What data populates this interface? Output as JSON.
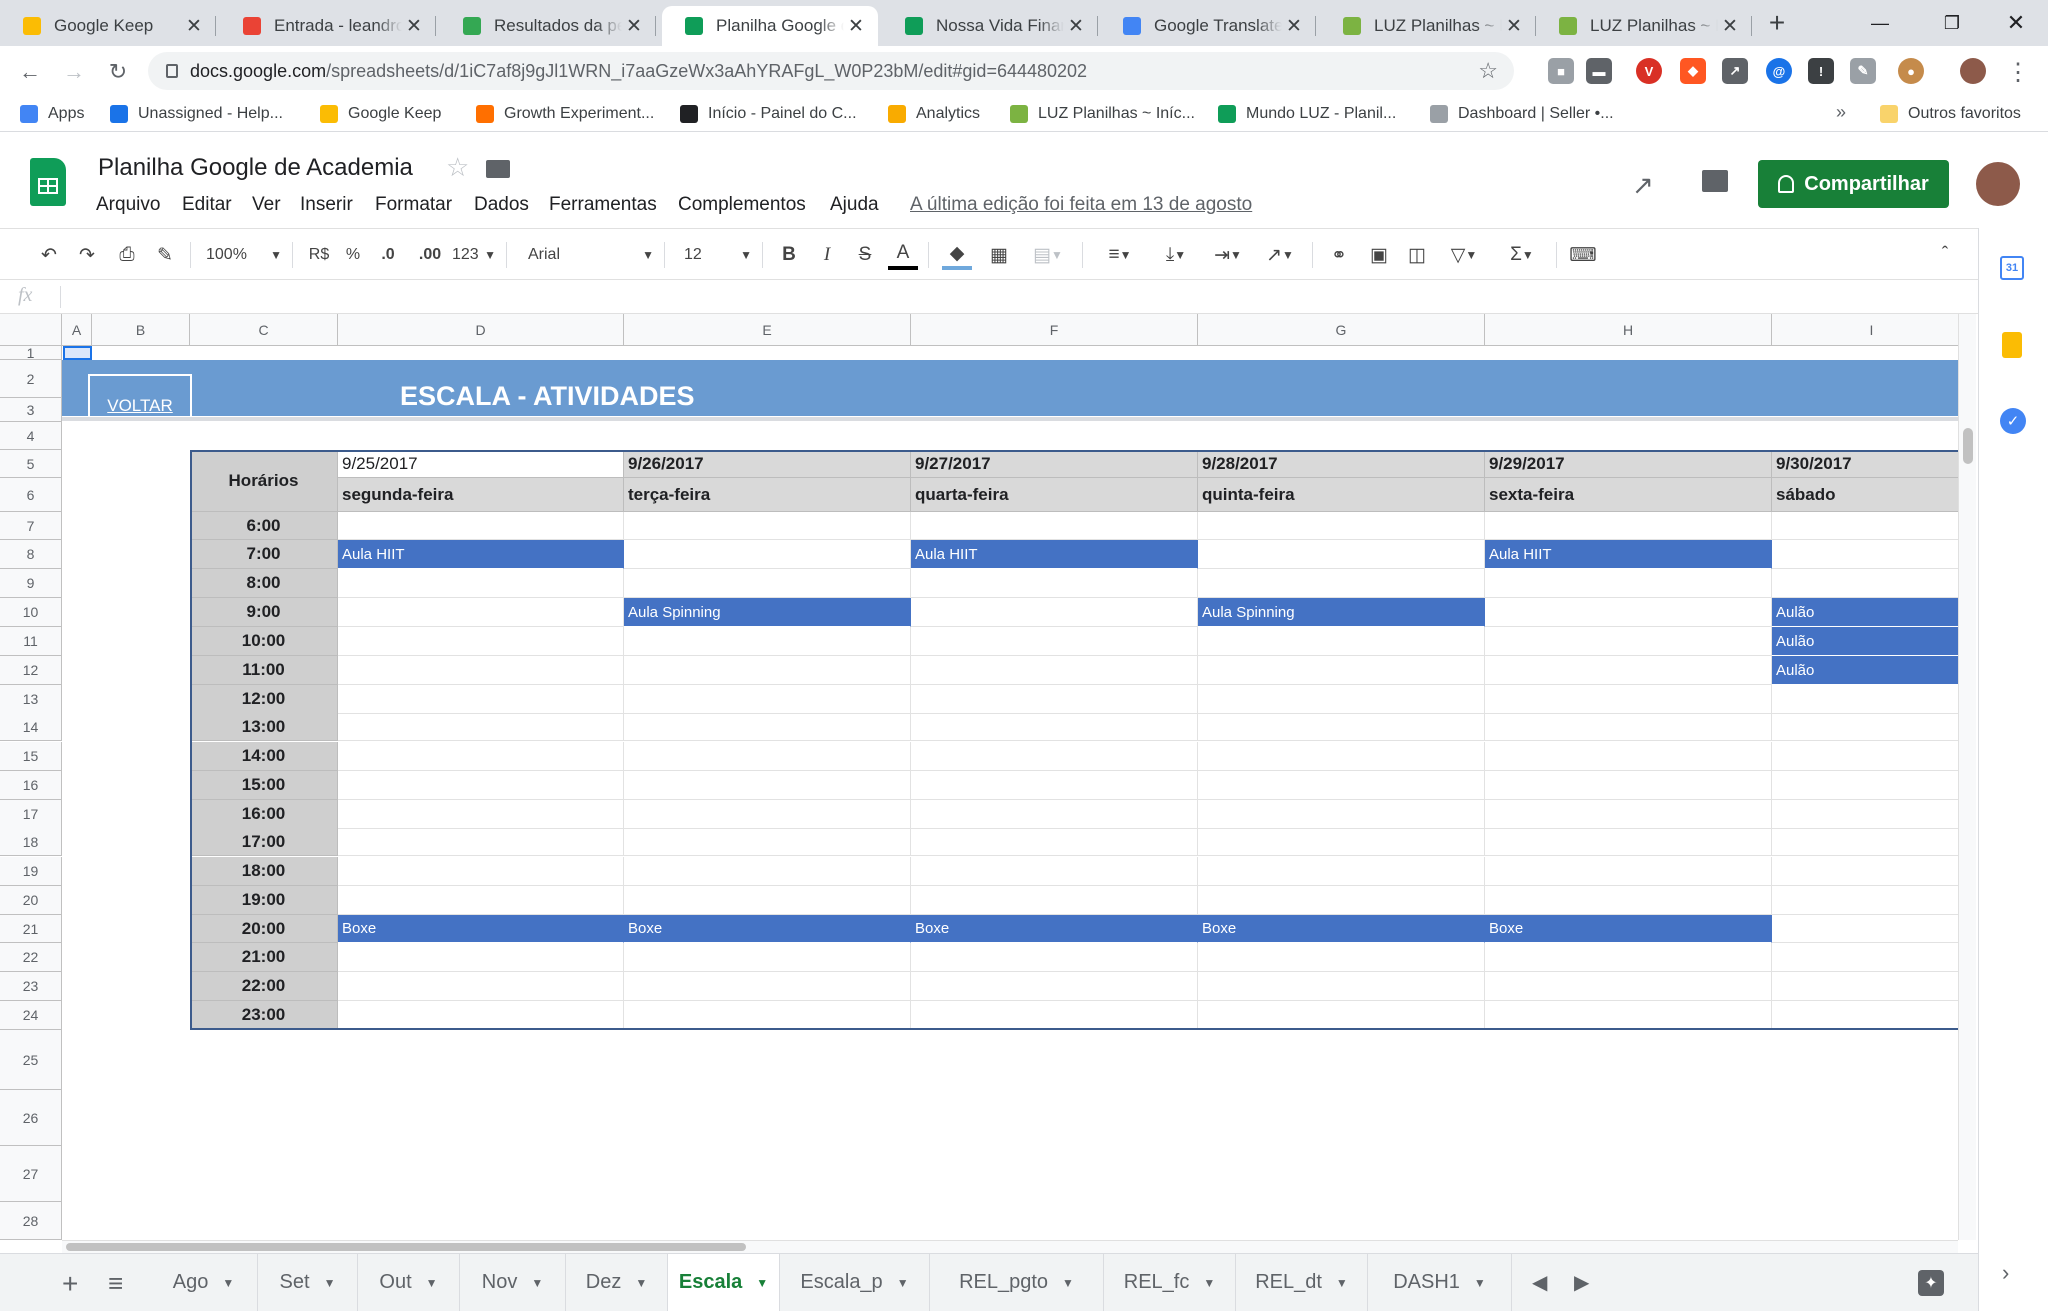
{
  "browser": {
    "tabs": [
      {
        "title": "Google Keep",
        "color": "#fbbc04",
        "active": false
      },
      {
        "title": "Entrada - leandro@",
        "color": "#ea4335",
        "active": false
      },
      {
        "title": "Resultados da pesquisa",
        "color": "#34a853",
        "active": false
      },
      {
        "title": "Planilha Google de Academia",
        "color": "#0f9d58",
        "active": true
      },
      {
        "title": "Nossa Vida Financeira",
        "color": "#0f9d58",
        "active": false
      },
      {
        "title": "Google Translate",
        "color": "#4285f4",
        "active": false
      },
      {
        "title": "LUZ Planilhas ~ Planilhas",
        "color": "#7cb342",
        "active": false
      },
      {
        "title": "LUZ Planilhas ~ Planilhas",
        "color": "#7cb342",
        "active": false
      }
    ],
    "url_host": "docs.google.com",
    "url_path": "/spreadsheets/d/1iC7af8j9gJl1WRN_i7aaGzeWx3aAhYRAFgL_W0P23bM/edit#gid=644480202",
    "bookmarks": [
      {
        "label": "Apps",
        "color": "#4285f4"
      },
      {
        "label": "Unassigned - Help...",
        "color": "#1a73e8"
      },
      {
        "label": "Google Keep",
        "color": "#fbbc04"
      },
      {
        "label": "Growth Experiment...",
        "color": "#ff6f00"
      },
      {
        "label": "Início - Painel do C...",
        "color": "#202124"
      },
      {
        "label": "Analytics",
        "color": "#f9ab00"
      },
      {
        "label": "LUZ Planilhas ~ Iníc...",
        "color": "#7cb342"
      },
      {
        "label": "Mundo LUZ - Planil...",
        "color": "#0f9d58"
      },
      {
        "label": "Dashboard | Seller •...",
        "color": "#9aa0a6"
      }
    ],
    "bookmarks_more": "»",
    "other_bookmarks": "Outros favoritos"
  },
  "sheets": {
    "title": "Planilha Google de Academia",
    "menu": [
      "Arquivo",
      "Editar",
      "Ver",
      "Inserir",
      "Formatar",
      "Dados",
      "Ferramentas",
      "Complementos",
      "Ajuda"
    ],
    "last_edit": "A última edição foi feita em 13 de agosto",
    "share_label": "Compartilhar",
    "toolbar": {
      "zoom": "100%",
      "currency": "R$",
      "percent": "%",
      "dec_less": ".0",
      "dec_more": ".00",
      "format_more": "123",
      "font": "Arial",
      "font_size": "12",
      "bold": "B",
      "italic": "I",
      "strike": "S",
      "textcolor": "A"
    },
    "fx": "fx"
  },
  "grid": {
    "columns": [
      "A",
      "B",
      "C",
      "D",
      "E",
      "F",
      "G",
      "H",
      "I"
    ],
    "rows": [
      "1",
      "2",
      "3",
      "4",
      "5",
      "6",
      "7",
      "8",
      "9",
      "10",
      "11",
      "12",
      "13",
      "14",
      "15",
      "16",
      "17",
      "18",
      "19",
      "20",
      "21",
      "22",
      "23",
      "24",
      "25",
      "26",
      "27",
      "28"
    ],
    "back_link": "VOLTAR",
    "banner_title": "ESCALA - ATIVIDADES",
    "schedule_header": "Horários",
    "dates": [
      "9/25/2017",
      "9/26/2017",
      "9/27/2017",
      "9/28/2017",
      "9/29/2017",
      "9/30/2017"
    ],
    "weekdays": [
      "segunda-feira",
      "terça-feira",
      "quarta-feira",
      "quinta-feira",
      "sexta-feira",
      "sábado"
    ],
    "hours": [
      "6:00",
      "7:00",
      "8:00",
      "9:00",
      "10:00",
      "11:00",
      "12:00",
      "13:00",
      "14:00",
      "15:00",
      "16:00",
      "17:00",
      "18:00",
      "19:00",
      "20:00",
      "21:00",
      "22:00",
      "23:00"
    ],
    "schedule": [
      [
        "",
        "",
        "",
        "",
        "",
        ""
      ],
      [
        "Aula HIIT",
        "",
        "Aula HIIT",
        "",
        "Aula HIIT",
        ""
      ],
      [
        "",
        "",
        "",
        "",
        "",
        ""
      ],
      [
        "",
        "Aula Spinning",
        "",
        "Aula Spinning",
        "",
        "Aulão"
      ],
      [
        "",
        "",
        "",
        "",
        "",
        "Aulão"
      ],
      [
        "",
        "",
        "",
        "",
        "",
        "Aulão"
      ],
      [
        "",
        "",
        "",
        "",
        "",
        ""
      ],
      [
        "",
        "",
        "",
        "",
        "",
        ""
      ],
      [
        "",
        "",
        "",
        "",
        "",
        ""
      ],
      [
        "",
        "",
        "",
        "",
        "",
        ""
      ],
      [
        "",
        "",
        "",
        "",
        "",
        ""
      ],
      [
        "",
        "",
        "",
        "",
        "",
        ""
      ],
      [
        "",
        "",
        "",
        "",
        "",
        ""
      ],
      [
        "",
        "",
        "",
        "",
        "",
        ""
      ],
      [
        "Boxe",
        "Boxe",
        "Boxe",
        "Boxe",
        "Boxe",
        ""
      ],
      [
        "",
        "",
        "",
        "",
        "",
        ""
      ],
      [
        "",
        "",
        "",
        "",
        "",
        ""
      ],
      [
        "",
        "",
        "",
        "",
        "",
        ""
      ]
    ],
    "banner_color": "#6a9bd1",
    "event_color": "#4472c4"
  },
  "sheet_tabs": {
    "tabs": [
      "Ago",
      "Set",
      "Out",
      "Nov",
      "Dez",
      "Escala",
      "Escala_p",
      "REL_pgto",
      "REL_fc",
      "REL_dt",
      "DASH1"
    ],
    "active": "Escala"
  }
}
